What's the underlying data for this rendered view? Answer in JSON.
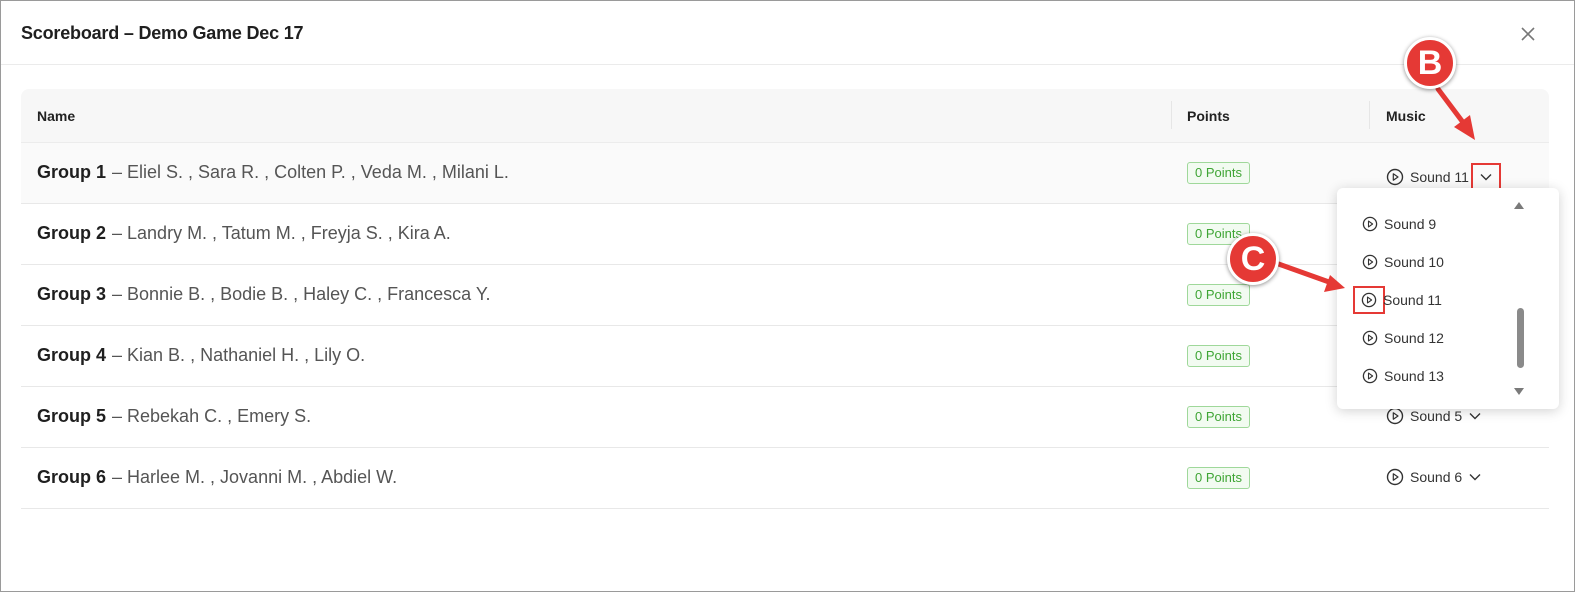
{
  "dialog": {
    "title": "Scoreboard – Demo Game Dec 17"
  },
  "table": {
    "headers": {
      "name": "Name",
      "points": "Points",
      "music": "Music"
    },
    "rows": [
      {
        "group": "Group 1",
        "members": "– Eliel S. ,  Sara R. ,  Colten P. ,  Veda M. ,  Milani L.",
        "points": "0 Points",
        "music": "Sound 11"
      },
      {
        "group": "Group 2",
        "members": "– Landry M. ,  Tatum M. ,  Freyja S. ,  Kira A.",
        "points": "0 Points",
        "music": ""
      },
      {
        "group": "Group 3",
        "members": "– Bonnie B. ,  Bodie B. ,  Haley C. ,  Francesca Y.",
        "points": "0 Points",
        "music": ""
      },
      {
        "group": "Group 4",
        "members": "– Kian B. ,  Nathaniel H. ,  Lily O.",
        "points": "0 Points",
        "music": ""
      },
      {
        "group": "Group 5",
        "members": "– Rebekah C. ,  Emery S.",
        "points": "0 Points",
        "music": "Sound 5"
      },
      {
        "group": "Group 6",
        "members": "– Harlee M. ,  Jovanni M. ,  Abdiel W.",
        "points": "0 Points",
        "music": "Sound 6"
      }
    ]
  },
  "dropdown": {
    "options": [
      "Sound 9",
      "Sound 10",
      "Sound 11",
      "Sound 12",
      "Sound 13"
    ],
    "highlighted": "Sound 11"
  },
  "callouts": {
    "b": "B",
    "c": "C"
  },
  "colors": {
    "accent": "#e53935",
    "points_green": "#3fa535",
    "badge_bg": "#f2fbf1"
  },
  "icons": [
    "close-icon",
    "play-circle-icon",
    "chevron-down-icon",
    "scroll-up-arrow-icon",
    "scroll-down-arrow-icon"
  ]
}
